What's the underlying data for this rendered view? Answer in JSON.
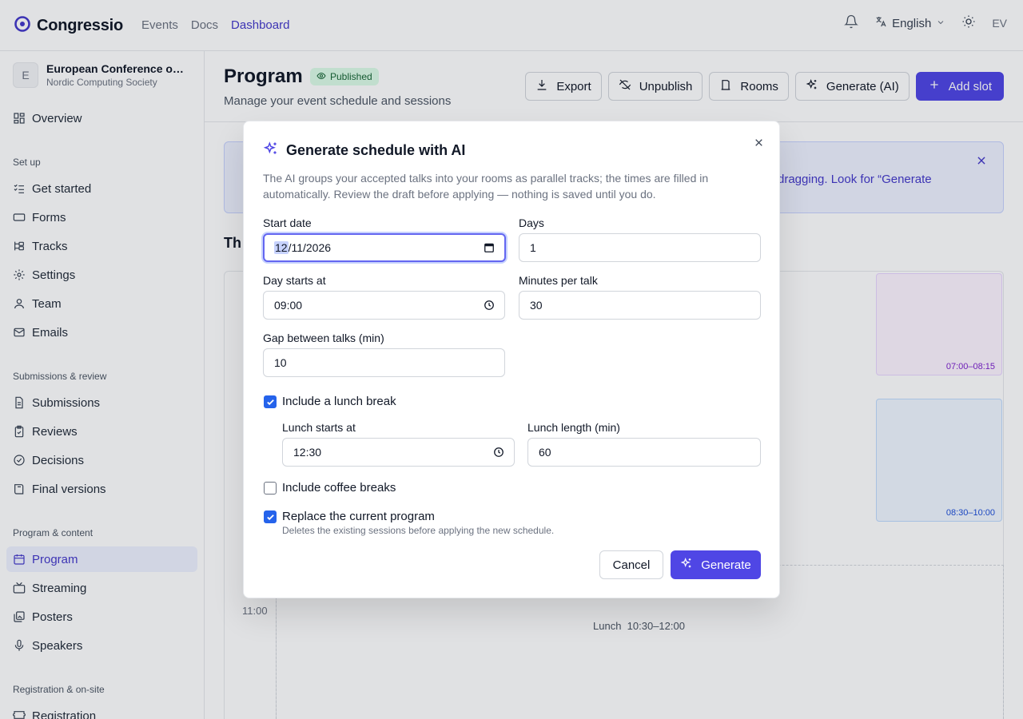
{
  "colors": {
    "accent": "#4f46e5",
    "accent_text": "#4338ca",
    "published_bg": "#dcfce7",
    "published_text": "#166534",
    "checkbox": "#2563eb"
  },
  "topnav": {
    "brand": "Congressio",
    "links": [
      "Events",
      "Docs",
      "Dashboard"
    ],
    "active_link": "Dashboard",
    "language": "English",
    "user_initials": "EV"
  },
  "sidebar": {
    "org_badge": "E",
    "org_name": "European Conference on Computing",
    "org_sub": "Nordic Computing Society",
    "overview": "Overview",
    "sections": [
      {
        "title": "Set up",
        "items": [
          "Get started",
          "Forms",
          "Tracks",
          "Settings",
          "Team",
          "Emails"
        ]
      },
      {
        "title": "Submissions & review",
        "items": [
          "Submissions",
          "Reviews",
          "Decisions",
          "Final versions"
        ]
      },
      {
        "title": "Program & content",
        "items": [
          "Program",
          "Streaming",
          "Posters",
          "Speakers"
        ]
      },
      {
        "title": "Registration & on-site",
        "items": [
          "Registration"
        ]
      }
    ],
    "active_item": "Program"
  },
  "main": {
    "title": "Program",
    "badge": "Published",
    "subtitle": "Manage your event schedule and sessions",
    "toolbar": {
      "export": "Export",
      "unpublish": "Unpublish",
      "rooms": "Rooms",
      "generate_ai": "Generate (AI)",
      "add_slot": "Add slot"
    },
    "banner_text": "dragging. Look for “Generate",
    "day_heading": "Th",
    "times": [
      "11:00"
    ],
    "sessions": [
      {
        "time": "07:00–08:15"
      },
      {
        "time": "08:30–10:00"
      }
    ],
    "lunch_label": "Lunch",
    "lunch_time": "10:30–12:00"
  },
  "modal": {
    "title": "Generate schedule with AI",
    "description": "The AI groups your accepted talks into your rooms as parallel tracks; the times are filled in automatically. Review the draft before applying — nothing is saved until you do.",
    "start_date": {
      "label": "Start date",
      "month": "12",
      "rest": "/11/2026"
    },
    "days": {
      "label": "Days",
      "value": "1"
    },
    "day_start": {
      "label": "Day starts at",
      "value": "09:00"
    },
    "minutes_per_talk": {
      "label": "Minutes per talk",
      "value": "30"
    },
    "gap": {
      "label": "Gap between talks (min)",
      "value": "10"
    },
    "lunch": {
      "label": "Include a lunch break",
      "checked": true
    },
    "lunch_start": {
      "label": "Lunch starts at",
      "value": "12:30"
    },
    "lunch_length": {
      "label": "Lunch length (min)",
      "value": "60"
    },
    "coffee": {
      "label": "Include coffee breaks",
      "checked": false
    },
    "replace": {
      "label": "Replace the current program",
      "hint": "Deletes the existing sessions before applying the new schedule.",
      "checked": true
    },
    "cancel": "Cancel",
    "generate": "Generate"
  }
}
